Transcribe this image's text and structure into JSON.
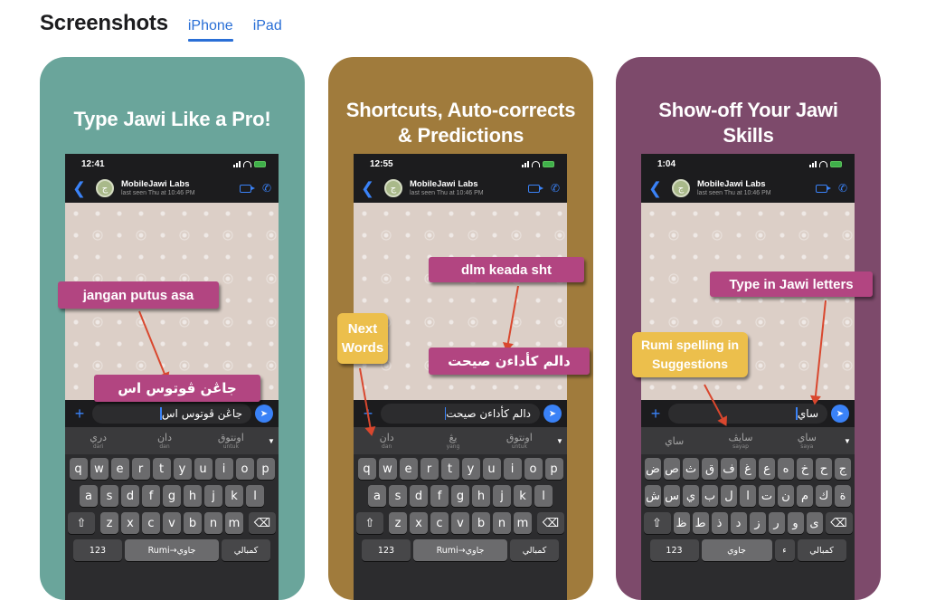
{
  "header": {
    "title": "Screenshots",
    "tabs": [
      {
        "label": "iPhone",
        "active": true
      },
      {
        "label": "iPad",
        "active": false
      }
    ],
    "accent_color": "#2a6fd6"
  },
  "cards": [
    {
      "bg_color": "#6aa59b",
      "title_lines": [
        "Type Jawi Like a Pro!"
      ],
      "phone": {
        "time": "12:41",
        "contact": "MobileJawi Labs",
        "last_seen": "last seen Thu at 10:46 PM",
        "avatar_glyph": "ج",
        "input_text": "جاڠن ڤوتوس اس",
        "suggestions": [
          {
            "jawi": "دري",
            "rumi": "dari"
          },
          {
            "jawi": "دان",
            "rumi": "dan"
          },
          {
            "jawi": "اونتوق",
            "rumi": "untuk"
          }
        ],
        "keyboard_rows": [
          [
            "q",
            "w",
            "e",
            "r",
            "t",
            "y",
            "u",
            "i",
            "o",
            "p"
          ],
          [
            "a",
            "s",
            "d",
            "f",
            "g",
            "h",
            "j",
            "k",
            "l"
          ],
          [
            "z",
            "x",
            "c",
            "v",
            "b",
            "n",
            "m"
          ]
        ],
        "bottom_row": [
          "123",
          "Rumi→جاوي",
          "كمبالي"
        ]
      },
      "callouts": [
        {
          "text": "jangan putus asa",
          "style": "pink"
        },
        {
          "text": "جاڠن ڤوتوس اس",
          "style": "pink"
        }
      ]
    },
    {
      "bg_color": "#a07b3c",
      "title_lines": [
        "Shortcuts, Auto-corrects",
        "& Predictions"
      ],
      "phone": {
        "time": "12:55",
        "contact": "MobileJawi Labs",
        "last_seen": "last seen Thu at 10:46 PM",
        "avatar_glyph": "ج",
        "input_text": "دالم كأداءن صيحت",
        "suggestions": [
          {
            "jawi": "دان",
            "rumi": "dan"
          },
          {
            "jawi": "يڠ",
            "rumi": "yang"
          },
          {
            "jawi": "اونتوق",
            "rumi": "untuk"
          }
        ],
        "keyboard_rows": [
          [
            "q",
            "w",
            "e",
            "r",
            "t",
            "y",
            "u",
            "i",
            "o",
            "p"
          ],
          [
            "a",
            "s",
            "d",
            "f",
            "g",
            "h",
            "j",
            "k",
            "l"
          ],
          [
            "z",
            "x",
            "c",
            "v",
            "b",
            "n",
            "m"
          ]
        ],
        "bottom_row": [
          "123",
          "Rumi→جاوي",
          "كمبالي"
        ]
      },
      "callouts": [
        {
          "text": "dlm keada sht",
          "style": "pink"
        },
        {
          "text": "دالم كأداءن صيحت",
          "style": "pink"
        },
        {
          "text": "Next Words",
          "style": "yellow"
        }
      ]
    },
    {
      "bg_color": "#7d4a6b",
      "title_lines": [
        "Show-off Your Jawi",
        "Skills"
      ],
      "phone": {
        "time": "1:04",
        "contact": "MobileJawi Labs",
        "last_seen": "last seen Thu at 10:46 PM",
        "avatar_glyph": "ج",
        "input_text": "ساي",
        "suggestions": [
          {
            "jawi": "ساي",
            "rumi": ""
          },
          {
            "jawi": "سايڤ",
            "rumi": "sayap"
          },
          {
            "jawi": "ساي",
            "rumi": "saya"
          }
        ],
        "keyboard_rows": [
          [
            "ض",
            "ص",
            "ث",
            "ق",
            "ف",
            "غ",
            "ع",
            "ه",
            "خ",
            "ح",
            "ج"
          ],
          [
            "ش",
            "س",
            "ي",
            "ب",
            "ل",
            "ا",
            "ت",
            "ن",
            "م",
            "ك",
            "ة"
          ],
          [
            "ظ",
            "ط",
            "ذ",
            "د",
            "ز",
            "ر",
            "و",
            "ى"
          ]
        ],
        "bottom_row": [
          "123",
          "جاوي",
          "ء",
          "كمبالي"
        ]
      },
      "callouts": [
        {
          "text": "Type in Jawi letters",
          "style": "pink"
        },
        {
          "text": "Rumi spelling in Suggestions",
          "style": "yellow"
        }
      ]
    }
  ]
}
